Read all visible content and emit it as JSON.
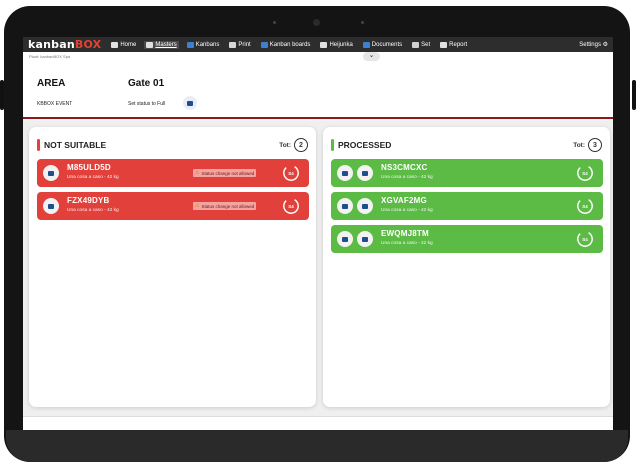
{
  "nav": {
    "logo_main": "kanban",
    "logo_accent": "BOX",
    "items": [
      {
        "label": "Home",
        "icon": "home-icon",
        "color": "#e0e0e0"
      },
      {
        "label": "Masters",
        "icon": "masters-icon",
        "color": "#e0e0e0",
        "active": true
      },
      {
        "label": "Kanbans",
        "icon": "kanban-icon",
        "color": "#3f7fd1"
      },
      {
        "label": "Print",
        "icon": "printer-icon",
        "color": "#d8d8d8"
      },
      {
        "label": "Kanban boards",
        "icon": "board-icon",
        "color": "#3f7fd1"
      },
      {
        "label": "Heijunka",
        "icon": "heijunka-icon",
        "color": "#e0e0e0"
      },
      {
        "label": "Documents",
        "icon": "documents-icon",
        "color": "#3f7fd1"
      },
      {
        "label": "Set",
        "icon": "set-icon",
        "color": "#d0d0d0"
      },
      {
        "label": "Report",
        "icon": "report-icon",
        "color": "#e0e0e0"
      }
    ],
    "settings": "Settings ⚙"
  },
  "breadcrumb": "Plant: kanbanBOX Spa",
  "area": {
    "label": "AREA",
    "value": "Gate 01",
    "event_label": "KBBOX EVENT",
    "event_value": "Set status to Full"
  },
  "panels": {
    "left": {
      "title": "NOT SUITABLE",
      "tot_label": "Tot:",
      "tot": "2",
      "color": "#e1413a",
      "cards": [
        {
          "code": "M85ULD5D",
          "desc": "Una cosa a caso - 42 kg",
          "warning": "Status change not allowed",
          "badge": "S4"
        },
        {
          "code": "FZX49DYB",
          "desc": "Una cosa a caso - 42 kg",
          "warning": "Status change not allowed",
          "badge": "S4"
        }
      ]
    },
    "right": {
      "title": "PROCESSED",
      "tot_label": "Tot:",
      "tot": "3",
      "color": "#5cbb45",
      "cards": [
        {
          "code": "NS3CMCXC",
          "desc": "Una cosa a caso - 42 kg",
          "badge": "S4"
        },
        {
          "code": "XGVAF2MG",
          "desc": "Una cosa a caso - 42 kg",
          "badge": "S4"
        },
        {
          "code": "EWQMJ8TM",
          "desc": "Una cosa a caso - 42 kg",
          "badge": "S4"
        }
      ]
    }
  }
}
